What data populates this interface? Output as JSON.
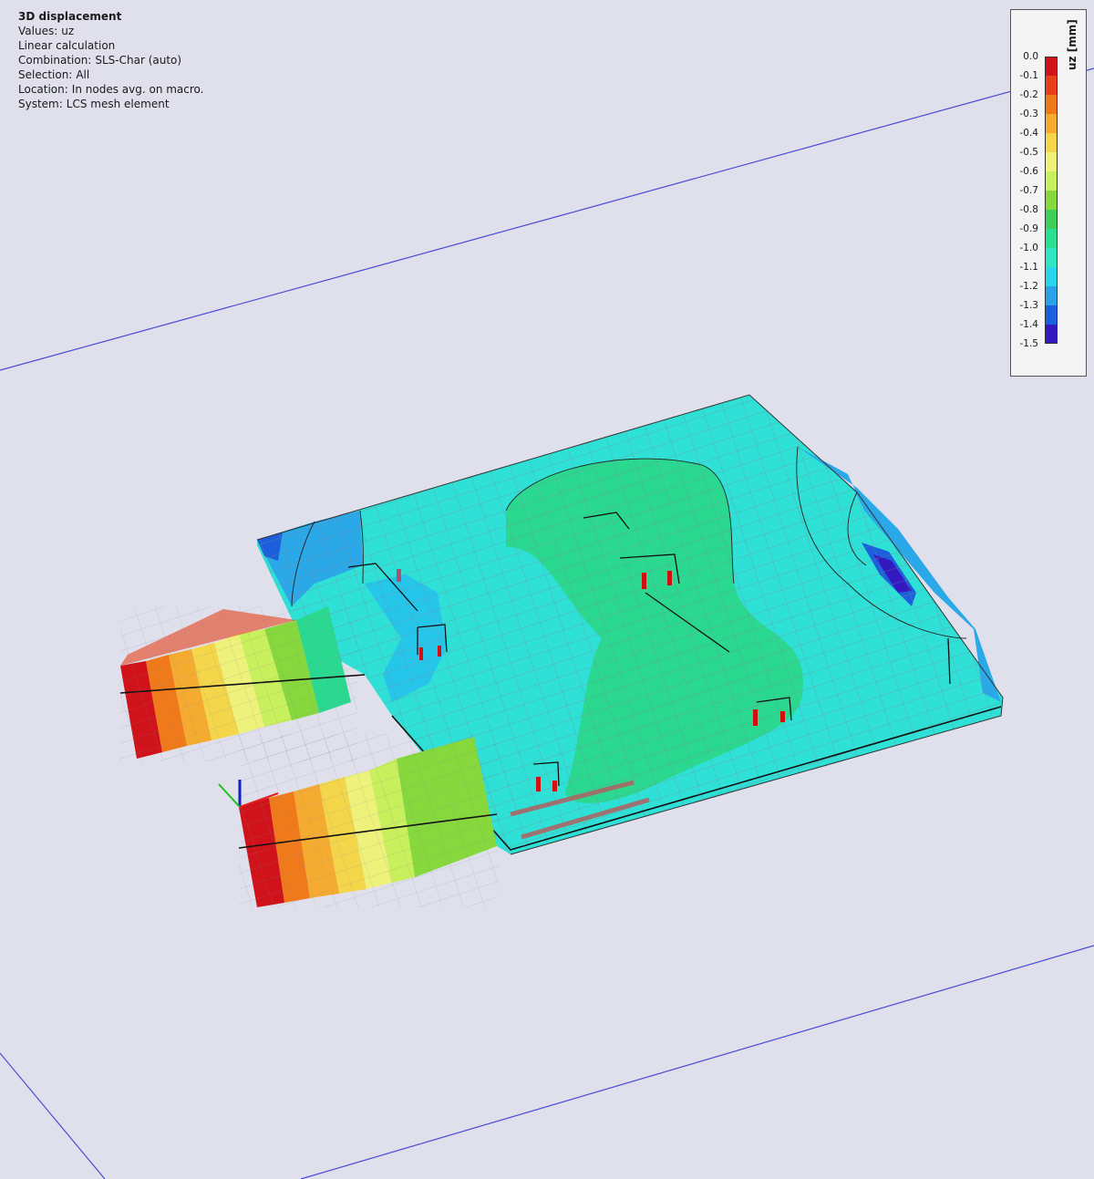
{
  "info": {
    "title": "3D displacement",
    "values_label": "Values:",
    "values": "uz",
    "calc": "Linear calculation",
    "combination_label": "Combination:",
    "combination": "SLS-Char (auto)",
    "selection_label": "Selection:",
    "selection": "All",
    "location_label": "Location:",
    "location": "In nodes avg. on macro.",
    "system_label": "System:",
    "system": "LCS mesh element"
  },
  "legend": {
    "unit": "uz [mm]",
    "ticks": [
      "0.0",
      "-0.1",
      "-0.2",
      "-0.3",
      "-0.4",
      "-0.5",
      "-0.6",
      "-0.7",
      "-0.8",
      "-0.9",
      "-1.0",
      "-1.1",
      "-1.2",
      "-1.3",
      "-1.4",
      "-1.5"
    ],
    "colors": [
      "#d0121a",
      "#e8401a",
      "#f07a1a",
      "#f5ab30",
      "#f4d64a",
      "#eef27a",
      "#c8ef5c",
      "#86d83c",
      "#3ecf5a",
      "#2adf92",
      "#2ee6c2",
      "#28d6ec",
      "#2aa3e6",
      "#1c5fdc",
      "#3418c0"
    ]
  },
  "model": {
    "colors": {
      "background": "#dfe0ec",
      "grid_line": "#4040d0",
      "mesh_line": "#8a8a9a",
      "edge": "#111111",
      "support": "#d01010",
      "axis_x": "#e02020",
      "axis_y": "#20c020",
      "axis_z": "#1020c0"
    }
  }
}
